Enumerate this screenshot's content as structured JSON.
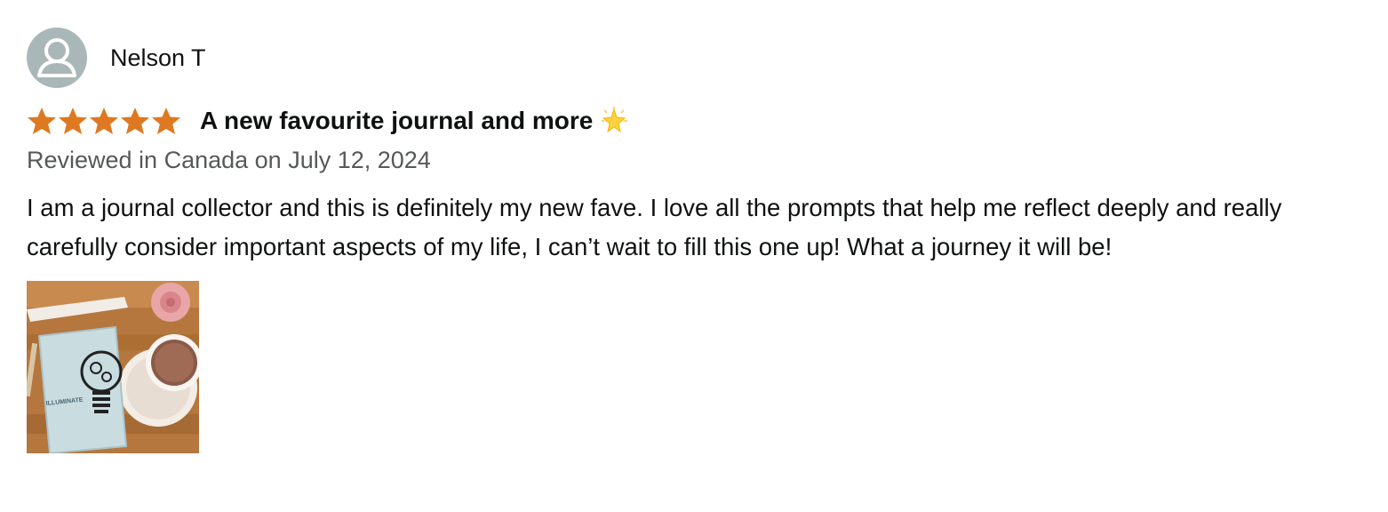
{
  "review": {
    "profile": {
      "name": "Nelson T",
      "avatar_icon": "default-user-avatar-icon"
    },
    "rating": {
      "stars": 5,
      "max_stars": 5,
      "color": "#de7921"
    },
    "title": "A new favourite journal and more",
    "title_emoji": "glowing-star-icon",
    "date_line": "Reviewed in Canada on July 12, 2024",
    "body": "I am a journal collector and this is definitely my new fave. I love all the prompts that help me reflect deeply and really carefully consider important aspects of my life, I can’t wait to fill this one up! What a journey it will be!",
    "images": [
      {
        "name": "review-photo",
        "cover_text": "ILLUMINATE"
      }
    ]
  }
}
